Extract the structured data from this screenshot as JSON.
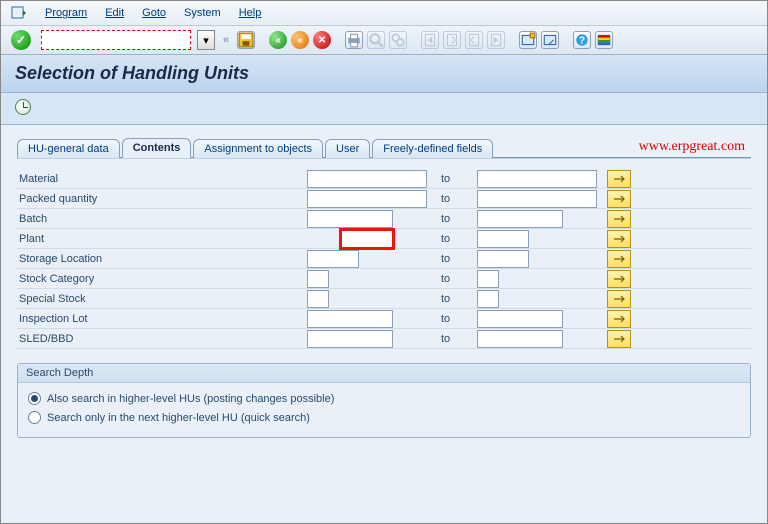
{
  "menu": {
    "program": "Program",
    "edit": "Edit",
    "goto": "Goto",
    "system": "System",
    "help": "Help"
  },
  "title": "Selection of Handling Units",
  "tabs": {
    "hu_general": "HU-general data",
    "contents": "Contents",
    "assignment": "Assignment to objects",
    "user": "User",
    "freely": "Freely-defined fields"
  },
  "watermark": "www.erpgreat.com",
  "sel": {
    "to": "to",
    "rows": {
      "material": "Material",
      "packed_qty": "Packed quantity",
      "batch": "Batch",
      "plant": "Plant",
      "storage_loc": "Storage Location",
      "stock_cat": "Stock Category",
      "special_stock": "Special Stock",
      "inspection_lot": "Inspection Lot",
      "sled_bbd": "SLED/BBD"
    }
  },
  "group": {
    "title": "Search Depth",
    "opt_higher": "Also search in higher-level HUs (posting changes possible)",
    "opt_next": "Search only in the next higher-level HU (quick search)"
  }
}
